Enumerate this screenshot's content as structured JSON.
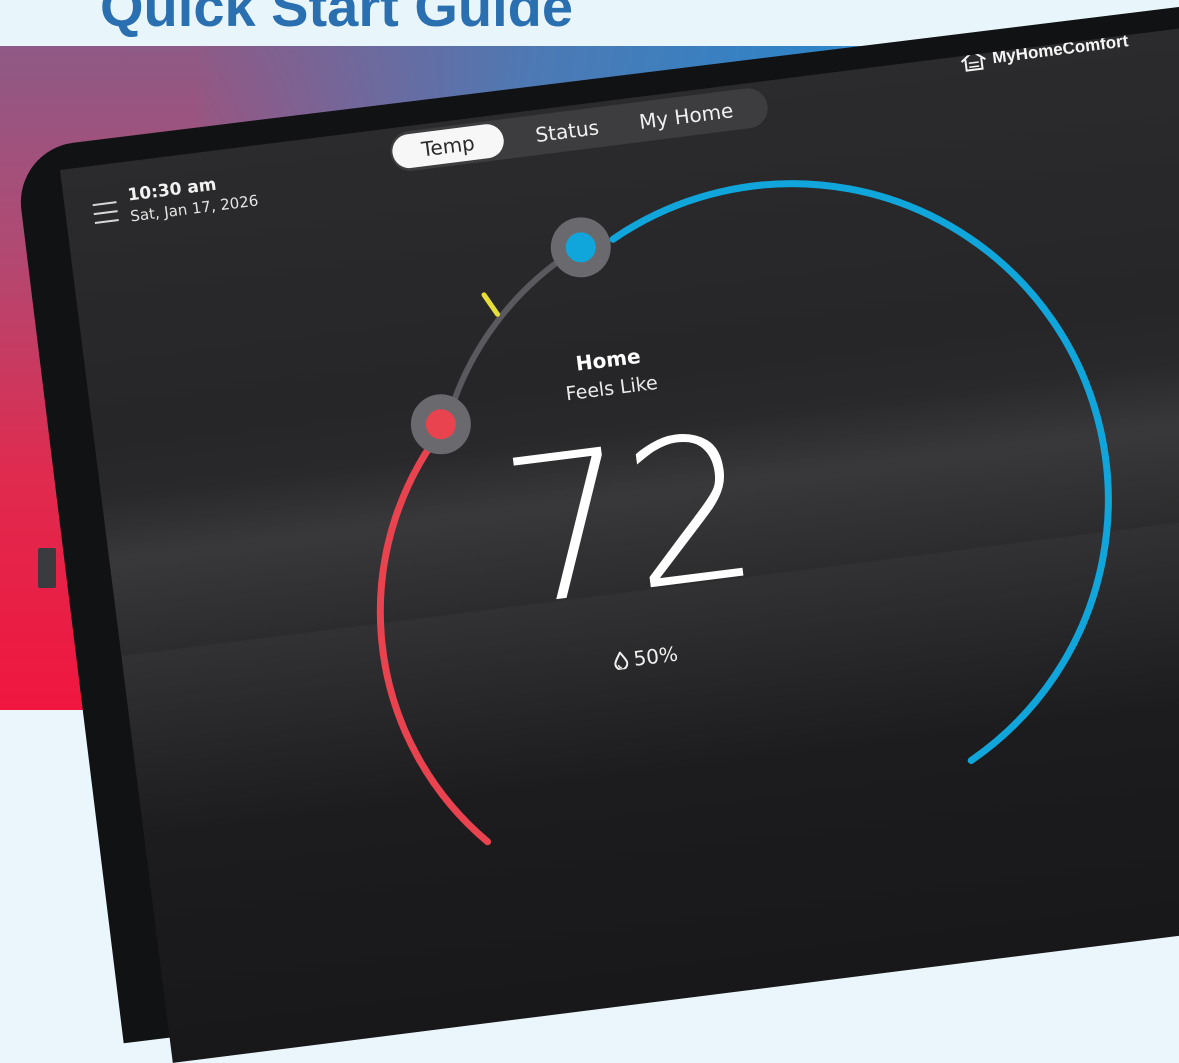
{
  "page": {
    "title": "Quick Start Guide"
  },
  "brand": {
    "name": "MyHomeComfort"
  },
  "header": {
    "time": "10:30 am",
    "date": "Sat, Jan 17, 2026"
  },
  "tabs": [
    {
      "label": "Temp",
      "active": true
    },
    {
      "label": "Status",
      "active": false
    },
    {
      "label": "My Home",
      "active": false
    }
  ],
  "thermostat": {
    "location": "Home",
    "feels_like_label": "Feels Like",
    "temperature": "72",
    "humidity": "50%"
  },
  "colors": {
    "heat": "#e8434f",
    "cool": "#10a6dc",
    "indicator": "#e6dc3a",
    "title": "#2a6fb0"
  },
  "icons": {
    "menu": "hamburger-menu-icon",
    "humidity": "water-drop-icon",
    "logo": "house-outline-icon"
  }
}
